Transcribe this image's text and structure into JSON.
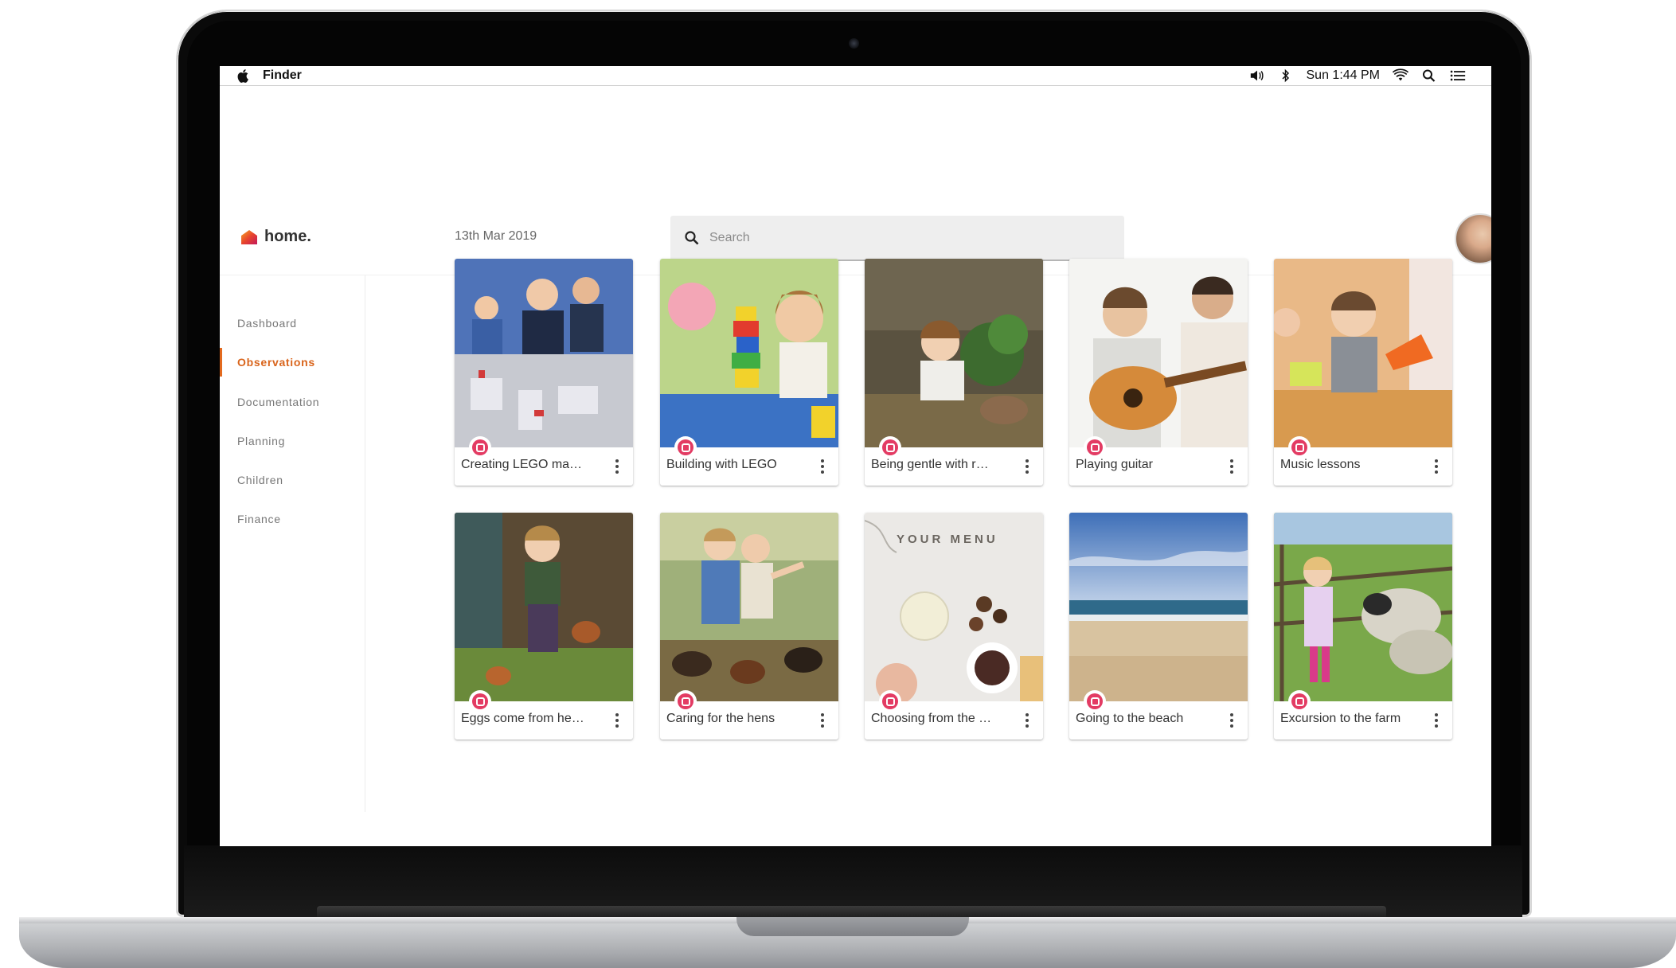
{
  "menubar": {
    "app_name": "Finder",
    "clock": "Sun 1:44 PM",
    "icons": [
      "apple-icon",
      "volume-icon",
      "bluetooth-icon",
      "wifi-icon",
      "spotlight-icon",
      "notification-list-icon"
    ]
  },
  "brand": {
    "name": "home.",
    "accent": "#e36a1f"
  },
  "search": {
    "placeholder": "Search",
    "value": ""
  },
  "sidebar": {
    "items": [
      {
        "label": "Dashboard",
        "active": false
      },
      {
        "label": "Observations",
        "active": true
      },
      {
        "label": "Documentation",
        "active": false
      },
      {
        "label": "Planning",
        "active": false
      },
      {
        "label": "Children",
        "active": false
      },
      {
        "label": "Finance",
        "active": false
      }
    ]
  },
  "main": {
    "date_heading": "13th Mar 2019",
    "cards": [
      {
        "title": "Creating LEGO ma…",
        "image": "lego-kids-photo"
      },
      {
        "title": "Building with LEGO",
        "image": "lego-tower-photo"
      },
      {
        "title": "Being gentle with r…",
        "image": "child-rabbit-photo"
      },
      {
        "title": "Playing guitar",
        "image": "guitar-photo"
      },
      {
        "title": "Music lessons",
        "image": "music-lesson-photo"
      },
      {
        "title": "Eggs come from he…",
        "image": "hens-eggs-photo"
      },
      {
        "title": "Caring for the hens",
        "image": "feeding-hens-photo"
      },
      {
        "title": "Choosing from the …",
        "image": "menu-table-photo",
        "image_text": "YOUR MENU"
      },
      {
        "title": "Going to the beach",
        "image": "beach-photo"
      },
      {
        "title": "Excursion to the farm",
        "image": "farm-sheep-photo"
      }
    ]
  },
  "colors": {
    "observation_badge": "#e33b63",
    "active_nav": "#d9641b"
  }
}
